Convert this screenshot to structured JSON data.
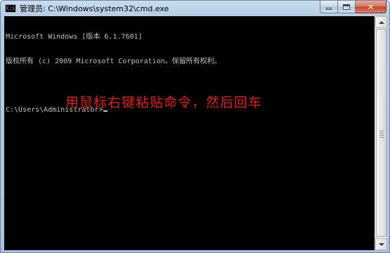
{
  "window": {
    "title": "管理员: C:\\Windows\\system32\\cmd.exe",
    "icon": "cmd-icon",
    "icon_text": "C:\\"
  },
  "console": {
    "lines": [
      "Microsoft Windows [版本 6.1.7601]",
      "版权所有 (c) 2009 Microsoft Corporation。保留所有权利。",
      "",
      "C:\\Users\\Administrator>"
    ]
  },
  "annotation": {
    "text": "用鼠标右键粘贴命令，然后回车",
    "color": "#e0201a"
  },
  "colors": {
    "console_bg": "#000000",
    "console_text": "#c0c0c0",
    "close_button": "#c4452c"
  }
}
